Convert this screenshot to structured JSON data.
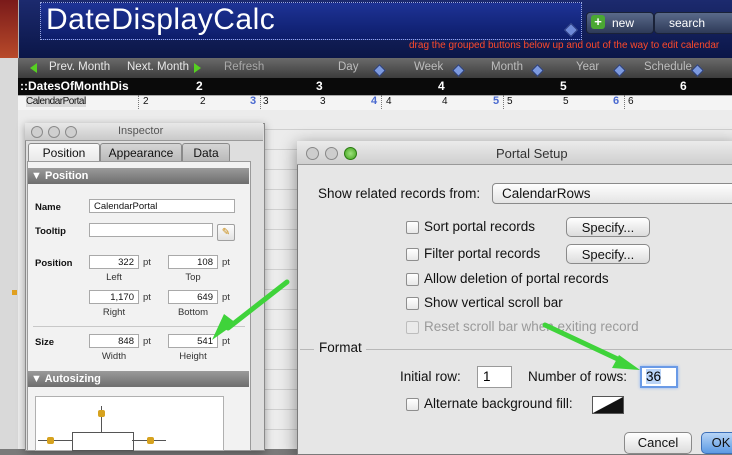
{
  "app": {
    "title": "DateDisplayCalc",
    "new_label": "new",
    "search_label": "search",
    "drag_note": "drag the grouped buttons below up and out of the way to edit calendar"
  },
  "nav": {
    "prev_month": "Prev. Month",
    "next_month": "Next. Month",
    "refresh": "Refresh",
    "day": "Day",
    "week": "Week",
    "month": "Month",
    "year": "Year",
    "schedule": "Schedule"
  },
  "dates_row": {
    "label": "::DatesOfMonthDis",
    "numbers": [
      "2",
      "3",
      "4",
      "5",
      "6"
    ]
  },
  "cal_row": {
    "portal_label": "CalendarPortal",
    "cells": [
      "2",
      "2",
      "3",
      "3",
      "3",
      "4",
      "4",
      "4",
      "5",
      "5",
      "5",
      "6",
      "6"
    ]
  },
  "inspector": {
    "title": "Inspector",
    "tabs": [
      "Position",
      "Appearance",
      "Data"
    ],
    "position_section": "Position",
    "name_label": "Name",
    "name_value": "CalendarPortal",
    "tooltip_label": "Tooltip",
    "tooltip_value": "",
    "position_label": "Position",
    "left_value": "322",
    "top_value": "108",
    "right_value": "1,170",
    "bottom_value": "649",
    "left_caption": "Left",
    "top_caption": "Top",
    "right_caption": "Right",
    "bottom_caption": "Bottom",
    "size_label": "Size",
    "width_value": "848",
    "height_value": "541",
    "width_caption": "Width",
    "height_caption": "Height",
    "unit": "pt",
    "autosizing_section": "Autosizing"
  },
  "dialog": {
    "title": "Portal Setup",
    "show_related_label": "Show related records from:",
    "related_value": "CalendarRows",
    "sort_label": "Sort portal records",
    "filter_label": "Filter portal records",
    "specify_label": "Specify...",
    "allow_deletion_label": "Allow deletion of portal records",
    "show_scroll_label": "Show vertical scroll bar",
    "reset_scroll_label": "Reset scroll bar when exiting record",
    "format_label": "Format",
    "initial_row_label": "Initial row:",
    "initial_row_value": "1",
    "num_rows_label": "Number of rows:",
    "num_rows_value": "36",
    "alt_bg_label": "Alternate background fill:",
    "cancel_label": "Cancel",
    "ok_label": "OK"
  },
  "colors": {
    "header_blue": "#0d1d6a",
    "accent_orange": "#ff4a2a",
    "nav_green": "#56d021",
    "arrow_green": "#3fd33a",
    "focus_blue": "#6a9ae6"
  }
}
